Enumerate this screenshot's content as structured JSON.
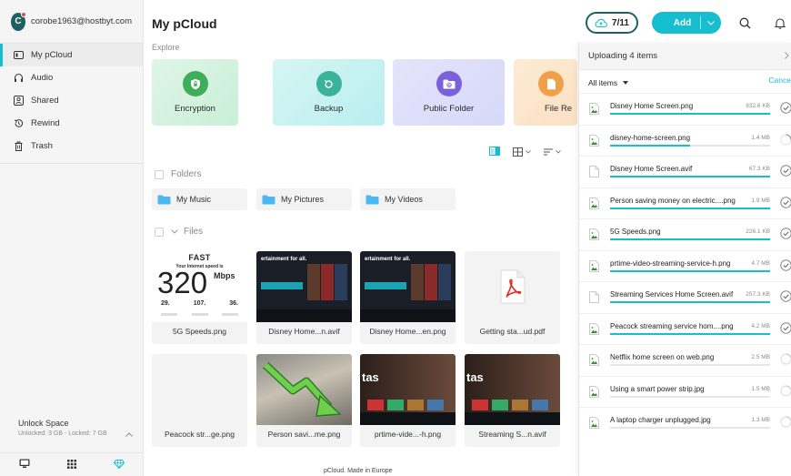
{
  "account": {
    "initial": "C",
    "email": "corobe1963@hostbyt.com"
  },
  "nav": [
    {
      "label": "My pCloud",
      "icon": "pcloud-icon",
      "active": true
    },
    {
      "label": "Audio",
      "icon": "headphones-icon"
    },
    {
      "label": "Shared",
      "icon": "shared-icon"
    },
    {
      "label": "Rewind",
      "icon": "rewind-icon"
    },
    {
      "label": "Trash",
      "icon": "trash-icon"
    }
  ],
  "unlock": {
    "title": "Unlock Space",
    "subtitle": "Unlocked: 3 GB - Locked: 7 GB"
  },
  "header": {
    "title": "My pCloud",
    "upload_count": "7/11",
    "add_label": "Add"
  },
  "explore": {
    "label": "Explore",
    "cards": [
      {
        "label": "Encryption",
        "icon": "shield-icon",
        "color": "#3fae5a"
      },
      {
        "label": "Backup",
        "icon": "backup-icon",
        "color": "#3bb39a"
      },
      {
        "label": "Public Folder",
        "icon": "folder-icon",
        "color": "#7b61d9"
      },
      {
        "label": "File Re",
        "icon": "file-request-icon",
        "color": "#f0a04b"
      }
    ]
  },
  "folders": {
    "label": "Folders",
    "items": [
      "My Music",
      "My Pictures",
      "My Videos"
    ]
  },
  "files": {
    "label": "Files",
    "items": [
      {
        "name": "5G Speeds.png"
      },
      {
        "name": "Disney Home...n.avif"
      },
      {
        "name": "Disney Home...en.png"
      },
      {
        "name": "Getting sta...ud.pdf"
      },
      {
        "name": "Peacock str...ge.png"
      },
      {
        "name": "Person savi...me.png"
      },
      {
        "name": "prtime-vide...-h.png"
      },
      {
        "name": "Streaming S...n.avif"
      }
    ]
  },
  "thumbs": {
    "speed": {
      "fast": "FAST",
      "sub": "Your Internet speed is",
      "value": "320",
      "unit": "Mbps",
      "stat1": "29.",
      "stat2": "107.",
      "stat3": "36."
    },
    "stream_headline": "ertainment for all.",
    "stream_headline2": "tas"
  },
  "upload_panel": {
    "title": "Uploading 4 items",
    "filter": "All items",
    "cancel": "Cance",
    "items": [
      {
        "name": "Disney Home Screen.png",
        "size": "832.6 KB",
        "progress": 1.0,
        "done": true,
        "type": "image"
      },
      {
        "name": "disney-home-screen.png",
        "size": "1.4 MB",
        "progress": 0.5,
        "done": false,
        "type": "image"
      },
      {
        "name": "Disney Home Screen.avif",
        "size": "67.3 KB",
        "progress": 1.0,
        "done": true,
        "type": "file"
      },
      {
        "name": "Person saving money on electric....png",
        "size": "1.9 MB",
        "progress": 1.0,
        "done": true,
        "type": "image"
      },
      {
        "name": "5G Speeds.png",
        "size": "226.1 KB",
        "progress": 1.0,
        "done": true,
        "type": "image"
      },
      {
        "name": "prtime-video-streaming-service-h.png",
        "size": "4.7 MB",
        "progress": 1.0,
        "done": true,
        "type": "image"
      },
      {
        "name": "Streaming Services Home Screen.avif",
        "size": "257.3 KB",
        "progress": 1.0,
        "done": true,
        "type": "file"
      },
      {
        "name": "Peacock streaming service hom....png",
        "size": "4.2 MB",
        "progress": 1.0,
        "done": true,
        "type": "image"
      },
      {
        "name": "Netflix home screen on web.png",
        "size": "2.5 MB",
        "progress": 0.0,
        "done": false,
        "type": "image"
      },
      {
        "name": "Using a smart power strip.jpg",
        "size": "1.5 MB",
        "progress": 0.0,
        "done": false,
        "type": "image"
      },
      {
        "name": "A laptop charger unplugged.jpg",
        "size": "1.3 MB",
        "progress": 0.0,
        "done": false,
        "type": "image"
      }
    ]
  },
  "footer": "pCloud. Made in Europe",
  "colors": {
    "accent": "#17bed0",
    "brand": "#1e5f63"
  }
}
